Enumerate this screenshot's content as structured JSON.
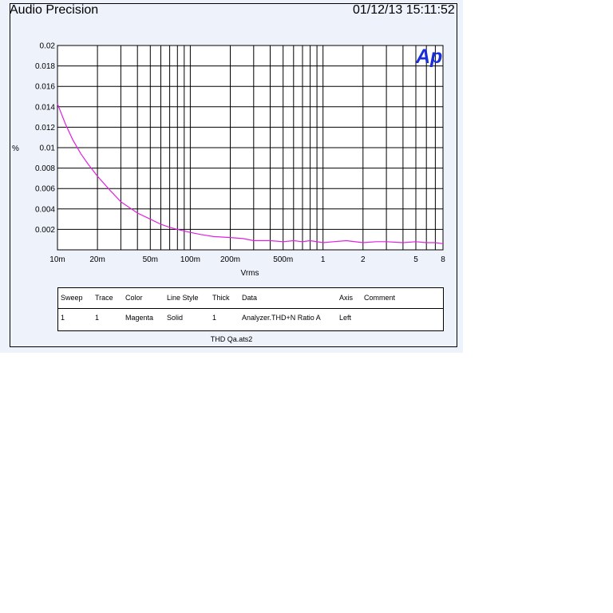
{
  "header": {
    "title": "Audio Precision",
    "timestamp": "01/12/13 15:11:52"
  },
  "logo": {
    "text": "Ap",
    "color": "#1a2ed8"
  },
  "chart_data": {
    "type": "line",
    "xscale": "log",
    "xlim": [
      0.01,
      8
    ],
    "ylim": [
      0,
      0.02
    ],
    "xlabel": "Vrms",
    "ylabel": "%",
    "grid": true,
    "xticks": [
      {
        "v": 0.01,
        "label": "10m"
      },
      {
        "v": 0.02,
        "label": "20m"
      },
      {
        "v": 0.05,
        "label": "50m"
      },
      {
        "v": 0.1,
        "label": "100m"
      },
      {
        "v": 0.2,
        "label": "200m"
      },
      {
        "v": 0.5,
        "label": "500m"
      },
      {
        "v": 1,
        "label": "1"
      },
      {
        "v": 2,
        "label": "2"
      },
      {
        "v": 5,
        "label": "5"
      },
      {
        "v": 8,
        "label": "8"
      }
    ],
    "yticks": [
      {
        "v": 0.002,
        "label": "0.002"
      },
      {
        "v": 0.004,
        "label": "0.004"
      },
      {
        "v": 0.006,
        "label": "0.006"
      },
      {
        "v": 0.008,
        "label": "0.008"
      },
      {
        "v": 0.01,
        "label": "0.01"
      },
      {
        "v": 0.012,
        "label": "0.012"
      },
      {
        "v": 0.014,
        "label": "0.014"
      },
      {
        "v": 0.016,
        "label": "0.016"
      },
      {
        "v": 0.018,
        "label": "0.018"
      },
      {
        "v": 0.02,
        "label": "0.02"
      }
    ],
    "series": [
      {
        "color": "#e020e0",
        "x": [
          0.01,
          0.0115,
          0.013,
          0.015,
          0.017,
          0.02,
          0.025,
          0.03,
          0.04,
          0.05,
          0.06,
          0.07,
          0.08,
          0.1,
          0.12,
          0.15,
          0.2,
          0.25,
          0.3,
          0.4,
          0.5,
          0.6,
          0.7,
          0.8,
          1,
          1.2,
          1.5,
          2,
          2.5,
          3,
          4,
          5,
          6,
          7,
          8
        ],
        "y": [
          0.0143,
          0.0123,
          0.0108,
          0.0094,
          0.0084,
          0.0072,
          0.0058,
          0.0047,
          0.0036,
          0.003,
          0.0025,
          0.0022,
          0.002,
          0.0017,
          0.0015,
          0.0013,
          0.0012,
          0.0011,
          0.0009,
          0.0009,
          0.0008,
          0.0009,
          0.0008,
          0.0009,
          0.0007,
          0.0008,
          0.0009,
          0.0007,
          0.0008,
          0.0008,
          0.0007,
          0.0008,
          0.0007,
          0.0007,
          0.0006
        ]
      }
    ]
  },
  "legend": {
    "headers": [
      "Sweep",
      "Trace",
      "Color",
      "Line Style",
      "Thick",
      "Data",
      "Axis",
      "Comment"
    ],
    "rows": [
      [
        "1",
        "1",
        "Magenta",
        "Solid",
        "1",
        "Analyzer.THD+N Ratio A",
        "Left",
        ""
      ]
    ]
  },
  "footer": {
    "filename": "THD Qa.ats2"
  }
}
